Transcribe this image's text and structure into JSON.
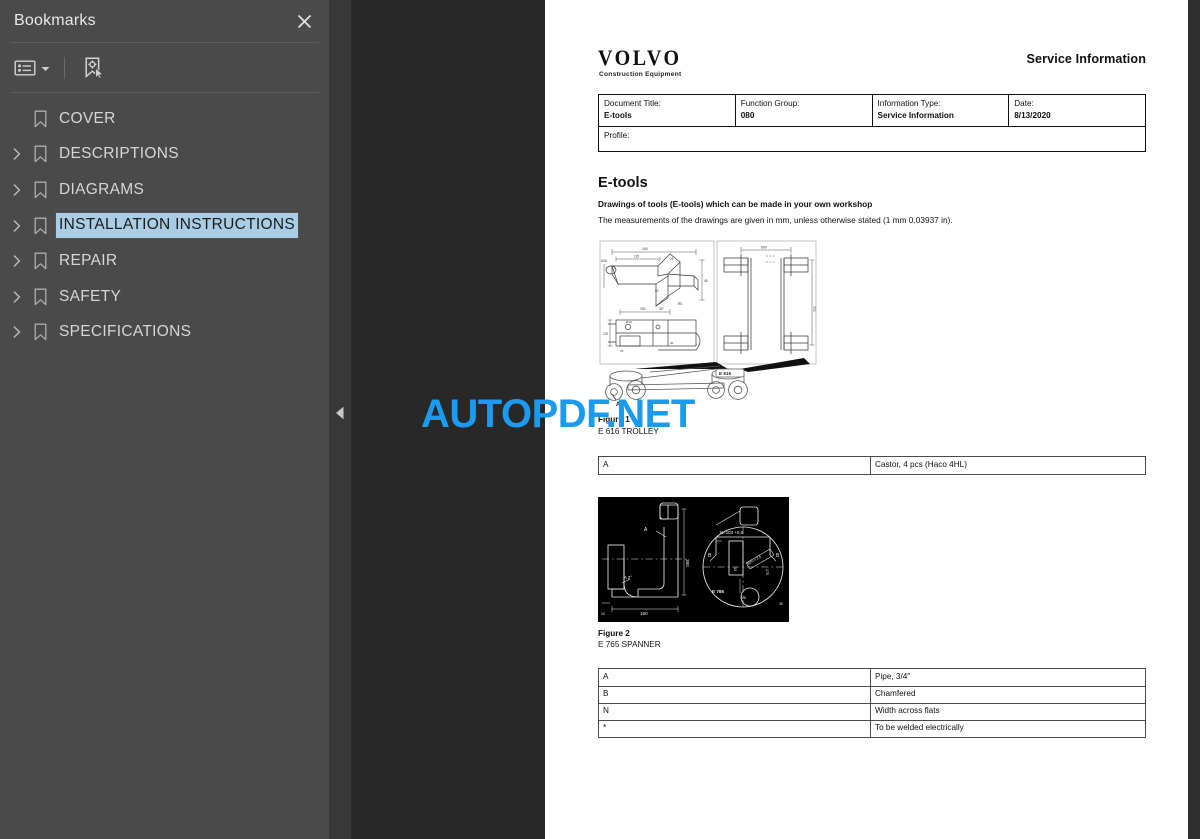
{
  "sidebar": {
    "title": "Bookmarks",
    "close_icon": "close-icon",
    "toolbar": {
      "options_icon": "list-options-icon",
      "chevron_icon": "chevron-down-icon",
      "new_bookmark_icon": "new-bookmark-icon"
    },
    "highlight_color": "#a8cde4",
    "items": [
      {
        "label": "COVER",
        "expandable": false,
        "selected": false
      },
      {
        "label": "DESCRIPTIONS",
        "expandable": true,
        "selected": false
      },
      {
        "label": "DIAGRAMS",
        "expandable": true,
        "selected": false
      },
      {
        "label": "INSTALLATION INSTRUCTIONS",
        "expandable": true,
        "selected": true
      },
      {
        "label": "REPAIR",
        "expandable": true,
        "selected": false
      },
      {
        "label": "SAFETY",
        "expandable": true,
        "selected": false
      },
      {
        "label": "SPECIFICATIONS",
        "expandable": true,
        "selected": false
      }
    ]
  },
  "gutter": {
    "collapse_icon": "triangle-left-icon"
  },
  "document": {
    "brand": {
      "logo_text": "VOLVO",
      "logo_subtitle": "Construction Equipment",
      "header_right": "Service Information"
    },
    "meta": [
      {
        "key": "Document Title:",
        "value": "E-tools"
      },
      {
        "key": "Function Group:",
        "value": "080"
      },
      {
        "key": "Information Type:",
        "value": "Service Information"
      },
      {
        "key": "Date:",
        "value": "8/13/2020"
      }
    ],
    "profile_label": "Profile:",
    "section_title": "E-tools",
    "lead_line_1": "Drawings of tools (E-tools) which can be made in your own workshop",
    "lead_line_2": "The measurements of the drawings are given in mm, unless otherwise stated (1 mm 0.03937 in).",
    "figure1": {
      "caption_title": "Figure 1",
      "caption_sub": "E 616 TROLLEY",
      "label_a": "A",
      "label_tool": "E 616"
    },
    "figure1_table": [
      {
        "ref": "A",
        "desc": "Castor, 4 pcs (Haco 4HL)"
      }
    ],
    "figure2": {
      "caption_title": "Figure 2",
      "caption_sub": "E 765 SPANNER",
      "label_a": "A",
      "label_b": "B",
      "label_n": "N=103 +0,5",
      "label_tool": "E 765",
      "label_len": "380",
      "label_width": "180"
    },
    "figure2_table": [
      {
        "ref": "A",
        "desc": "Pipe, 3/4\""
      },
      {
        "ref": "B",
        "desc": "Chamfered"
      },
      {
        "ref": "N",
        "desc": "Width across flats"
      },
      {
        "ref": "*",
        "desc": "To be welded electrically"
      }
    ]
  },
  "watermark": {
    "text": "AUTOPDF.NET",
    "color": "#1a9bf0"
  }
}
